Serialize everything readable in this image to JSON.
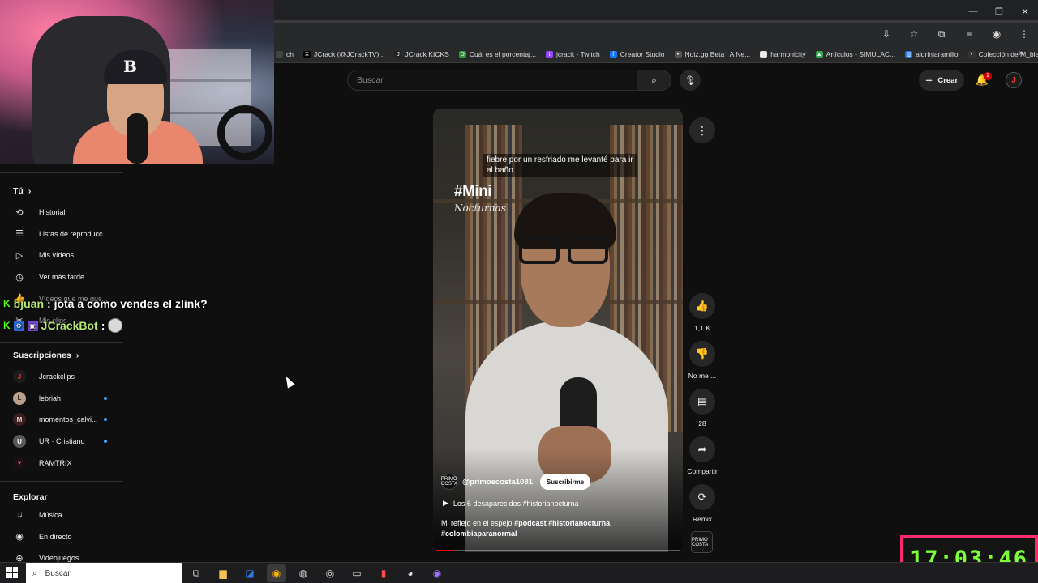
{
  "browser": {
    "window_controls": [
      "—",
      "❐",
      "✕"
    ],
    "bookmarks": [
      {
        "label": "ch",
        "color": "#444444",
        "glyph": ""
      },
      {
        "label": "JCrack (@JCrackTV)...",
        "color": "#000000",
        "glyph": "X"
      },
      {
        "label": "JCrack KICKS",
        "color": "#222222",
        "glyph": "J"
      },
      {
        "label": "Cuál es el porcentaj...",
        "color": "#2e9a3e",
        "glyph": "D"
      },
      {
        "label": "jcrack - Twitch",
        "color": "#9146ff",
        "glyph": "t"
      },
      {
        "label": "Creator Studio",
        "color": "#1877f2",
        "glyph": "f"
      },
      {
        "label": "Noiz.gg Beta | A Ne...",
        "color": "#555555",
        "glyph": "•"
      },
      {
        "label": "harmonicity",
        "color": "#dddddd",
        "glyph": "▤"
      },
      {
        "label": "Artículos - SIMULAC...",
        "color": "#34a853",
        "glyph": "▲"
      },
      {
        "label": "aldrinjaramillo",
        "color": "#1a73e8",
        "glyph": "▥"
      },
      {
        "label": "Colección de M_blei...",
        "color": "#333333",
        "glyph": "•"
      }
    ],
    "bookmarks_more": "»"
  },
  "chat": [
    {
      "user": "bjuan",
      "message": ": jota a como vendes el zlink?"
    },
    {
      "user": "JCrackBot",
      "message": ":"
    }
  ],
  "sidebar": {
    "you_title": "Tú",
    "you_items": [
      {
        "label": "Historial",
        "icon": "⟲"
      },
      {
        "label": "Listas de reproducc...",
        "icon": "☰"
      },
      {
        "label": "Mis vídeos",
        "icon": "▷"
      },
      {
        "label": "Ver más tarde",
        "icon": "◷"
      },
      {
        "label": "Vídeos que me gus...",
        "icon": "👍"
      },
      {
        "label": "Mis clips",
        "icon": "✂"
      }
    ],
    "subs_title": "Suscripciones",
    "subs": [
      {
        "label": "Jcrackclips",
        "avatar_bg": "#1b1b1b",
        "avatar_color": "#e33333",
        "glyph": "J",
        "new": false
      },
      {
        "label": "lebriah",
        "avatar_bg": "#b9a08a",
        "avatar_color": "#3a2a20",
        "glyph": "L",
        "new": true
      },
      {
        "label": "momentos_calvi...",
        "avatar_bg": "#3a1f1f",
        "avatar_color": "#f0d0d0",
        "glyph": "M",
        "new": true
      },
      {
        "label": "UR · Cristiano",
        "avatar_bg": "#5a5a5a",
        "avatar_color": "#ffffff",
        "glyph": "U",
        "new": true
      },
      {
        "label": "RAMTRIX",
        "avatar_bg": "#1a0f12",
        "avatar_color": "#ff4d6a",
        "glyph": "♥",
        "new": false
      }
    ],
    "explore_title": "Explorar",
    "explore": [
      {
        "label": "Música",
        "icon": "♫"
      },
      {
        "label": "En directo",
        "icon": "◉"
      },
      {
        "label": "Videojuegos",
        "icon": "⊕"
      }
    ]
  },
  "youtube": {
    "search_placeholder": "Buscar",
    "create_label": "Crear",
    "notifications_count": "1",
    "short": {
      "caption": "fiebre por un resfriado me levanté para ir al baño",
      "title_tag": "#Mini",
      "subtitle_tag": "Nocturnas",
      "channel": "@primoecosta1081",
      "channel_avatar_text": "PRIMO COSTA",
      "subscribe_label": "Suscribirme",
      "playlist": "Los 6 desaparecidos #historianocturna",
      "description_plain": "Mi reflejo en el espejo",
      "description_tags": "#podcast #historianocturna #colombiaparanormal",
      "progress_fraction": 0.07
    },
    "actions": {
      "likes": "1,1 K",
      "dislike_label": "No me ...",
      "comments": "28",
      "share_label": "Compartir",
      "remix_label": "Remix"
    }
  },
  "overlay": {
    "clock": "17:03:46"
  },
  "taskbar": {
    "search_label": "Buscar"
  }
}
